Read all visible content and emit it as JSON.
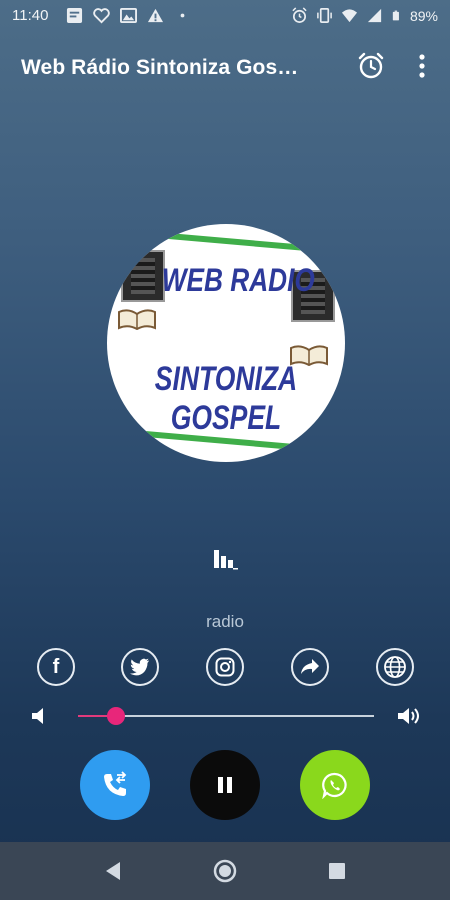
{
  "status_bar": {
    "time": "11:40",
    "battery": "89%",
    "left_icons": [
      "message-icon",
      "heart-icon",
      "gallery-icon",
      "warning-icon",
      "dot-icon"
    ],
    "right_icons": [
      "alarm-icon",
      "vibrate-icon",
      "wifi-icon",
      "signal-icon",
      "battery-icon"
    ]
  },
  "app_bar": {
    "title": "Web Rádio Sintoniza Gos…",
    "actions": [
      "alarm-clock-icon",
      "more-vert-icon"
    ]
  },
  "logo": {
    "line1": "WEB RADIO",
    "line2": "SINTONIZA GOSPEL",
    "text_color": "#2d3a9a",
    "stripe_color": "#3fae49"
  },
  "player": {
    "station_label": "radio",
    "equalizer_icon": "equalizer-icon",
    "volume_level": 0.13,
    "volume_accent": "#e8267a"
  },
  "social": [
    {
      "icon": "facebook-icon",
      "glyph": "f"
    },
    {
      "icon": "twitter-icon"
    },
    {
      "icon": "instagram-icon"
    },
    {
      "icon": "share-icon"
    },
    {
      "icon": "globe-icon"
    }
  ],
  "controls": {
    "call": {
      "icon": "phone-call-icon",
      "color": "#2f9cf0"
    },
    "play_pause": {
      "icon": "pause-icon",
      "color": "#0b0b0b"
    },
    "whatsapp": {
      "icon": "whatsapp-icon",
      "color": "#8ad81c"
    }
  },
  "nav_bar": {
    "items": [
      "back-icon",
      "home-icon",
      "recents-icon"
    ],
    "color": "#3a4655"
  }
}
